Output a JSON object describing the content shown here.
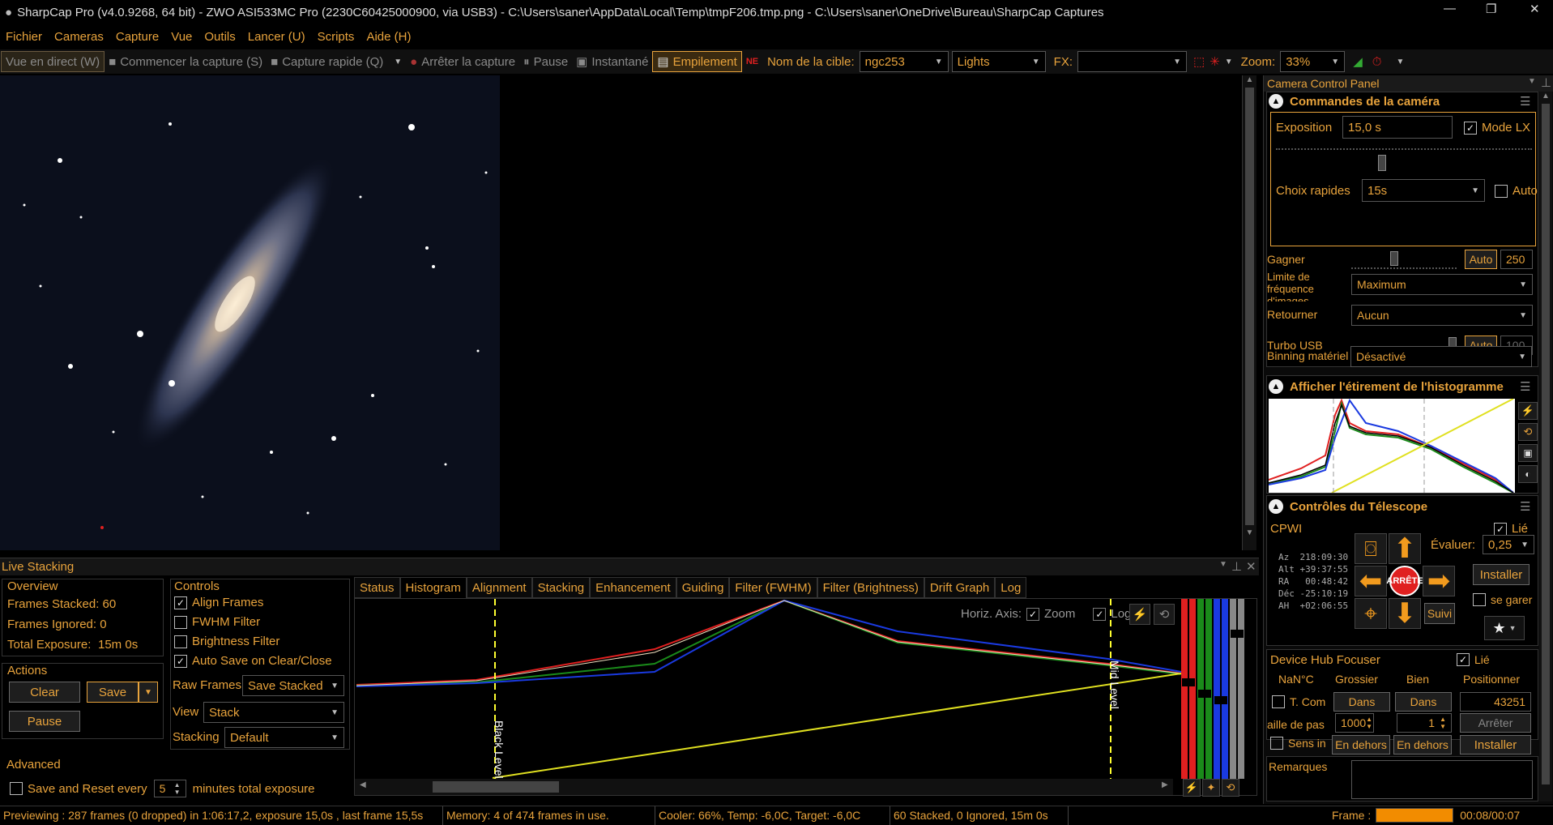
{
  "window": {
    "title": "SharpCap Pro (v4.0.9268, 64 bit) - ZWO ASI533MC Pro (2230C60425000900, via USB3) - C:\\Users\\saner\\AppData\\Local\\Temp\\tmpF206.tmp.png - C:\\Users\\saner\\OneDrive\\Bureau\\SharpCap Captures"
  },
  "menu": [
    "Fichier",
    "Cameras",
    "Capture",
    "Vue",
    "Outils",
    "Lancer (U)",
    "Scripts",
    "Aide (H)"
  ],
  "toolbar": {
    "live_view": "Vue en direct (W)",
    "start_capture": "Commencer la capture (S)",
    "quick_capture": "Capture rapide (Q)",
    "stop_capture": "Arrêter la capture",
    "pause": "Pause",
    "snapshot": "Instantané",
    "stacking": "Empilement",
    "target_label": "Nom de la cible:",
    "target_value": "ngc253",
    "frame_type": "Lights",
    "fx_label": "FX:",
    "fx_value": "",
    "zoom_label": "Zoom:",
    "zoom_value": "33%"
  },
  "live_stacking": {
    "title": "Live Stacking",
    "overview": {
      "heading": "Overview",
      "frames_stacked": "Frames Stacked: 60",
      "frames_ignored": "Frames Ignored: 0",
      "total_exposure_label": "Total Exposure:",
      "total_exposure_value": "15m 0s"
    },
    "actions": {
      "heading": "Actions",
      "clear": "Clear",
      "save": "Save",
      "pause": "Pause"
    },
    "advanced": {
      "heading": "Advanced",
      "save_reset_label": "Save and Reset every",
      "save_reset_value": "5",
      "save_reset_suffix": "minutes total exposure"
    },
    "controls": {
      "heading": "Controls",
      "align_frames": "Align Frames",
      "fwhm_filter": "FWHM Filter",
      "brightness_filter": "Brightness Filter",
      "auto_save": "Auto Save on Clear/Close",
      "raw_frames_label": "Raw Frames",
      "raw_frames_value": "Save Stacked",
      "view_label": "View",
      "view_value": "Stack",
      "stacking_label": "Stacking",
      "stacking_value": "Default"
    },
    "tabs": [
      "Status",
      "Histogram",
      "Alignment",
      "Stacking",
      "Enhancement",
      "Guiding",
      "Filter (FWHM)",
      "Filter (Brightness)",
      "Drift Graph",
      "Log"
    ],
    "active_tab": "Histogram",
    "histogram": {
      "horiz_axis": "Horiz. Axis:",
      "zoom": "Zoom",
      "log": "Log",
      "black_level": "Black Level",
      "mid_level": "Mid Level"
    }
  },
  "ccp": {
    "title": "Camera Control Panel",
    "camera": {
      "heading": "Commandes de la caméra",
      "exposure_label": "Exposition",
      "exposure_value": "15,0 s",
      "lx_mode": "Mode LX",
      "quick_label": "Choix rapides",
      "quick_value": "15s",
      "auto": "Auto",
      "gain_label": "Gagner",
      "gain_auto": "Auto",
      "gain_value": "250",
      "fps_label": "Limite de fréquence d'images",
      "fps_value": "Maximum",
      "flip_label": "Retourner",
      "flip_value": "Aucun",
      "usb_label": "Turbo USB",
      "usb_auto": "Auto",
      "usb_value": "100",
      "binning_label": "Binning matériel",
      "binning_value": "Désactivé"
    },
    "histogram": {
      "heading": "Afficher l'étirement de l'histogramme"
    },
    "telescope": {
      "heading": "Contrôles du Télescope",
      "mount": "CPWI",
      "linked": "Lié",
      "coords": [
        "Az  218:09:30",
        "Alt +39:37:55",
        "RA   00:48:42",
        "Déc -25:10:19",
        "AH  +02:06:55"
      ],
      "rate_label": "Évaluer:",
      "rate_value": "0,25",
      "install": "Installer",
      "park": "se garer",
      "stop": "ARRÊTE",
      "track": "Suivi"
    },
    "focuser": {
      "heading": "Device Hub Focuser",
      "linked": "Lié",
      "temp": "NaN°C",
      "coarse": "Grossier",
      "fine": "Bien",
      "position": "Positionner",
      "tcomp": "T. Com",
      "in1": "Dans",
      "in2": "Dans",
      "pos_value": "43251",
      "step_label": "aille de pas",
      "step_value": "1000",
      "fine_value": "1",
      "stop": "Arrêter",
      "reverse": "Sens in",
      "out1": "En dehors",
      "out2": "En dehors",
      "install": "Installer",
      "notes": "Remarques"
    }
  },
  "status": {
    "preview": "Previewing : 287 frames (0 dropped) in 1:06:17,2, exposure 15,0s , last frame 15,5s",
    "memory": "Memory: 4 of 474 frames in use.",
    "cooler": "Cooler: 66%, Temp: -6,0C, Target: -6,0C",
    "stacked": "60 Stacked, 0 Ignored, 15m 0s",
    "frame_label": "Frame :",
    "frame_time": "00:08/00:07",
    "frame_progress": 1.0
  },
  "colors": {
    "accent": "#e8a33c",
    "red": "#e0211a",
    "green": "#1a8a1a",
    "blue": "#1a3ae0"
  }
}
